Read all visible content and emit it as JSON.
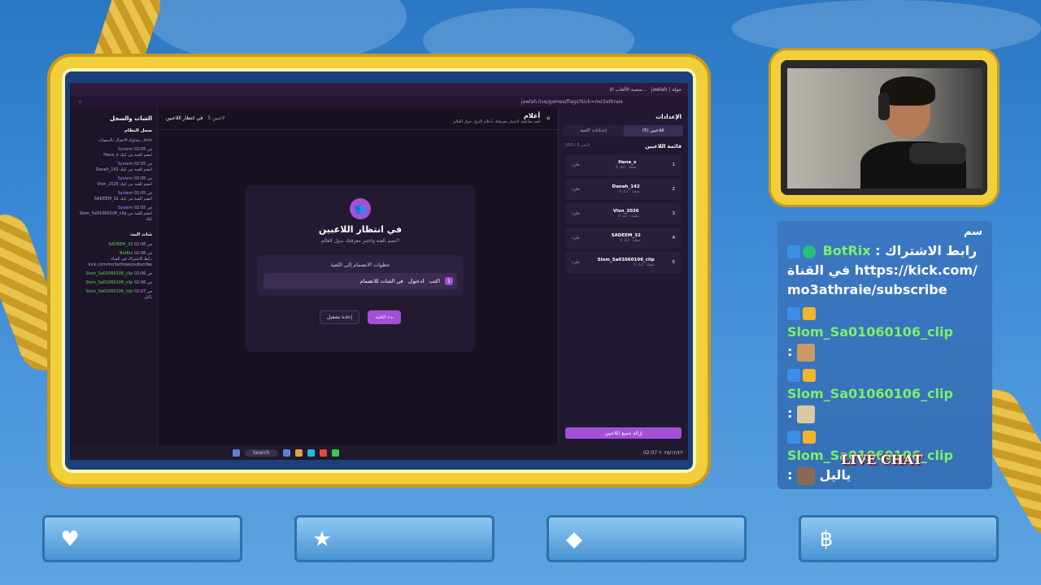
{
  "browser": {
    "tab_labels": [
      "منصة الألعاب الا...",
      "jawlah | جولة"
    ],
    "url": "jawlah.live/games/flags?kick=mo3athraie"
  },
  "left_panel": {
    "title": "الشات والسجل",
    "log_title": "سجل النظام",
    "log_items": [
      {
        "name": "",
        "text": "محاولة الاتصال بالمنصات...kick"
      },
      {
        "name": "System",
        "time": "02:05 ص",
        "text": "Hana_x انضم للعبة من كيك"
      },
      {
        "name": "System",
        "time": "02:05 ص",
        "text": "Danah_142 انضم للعبة من كيك"
      },
      {
        "name": "System",
        "time": "02:05 ص",
        "text": "Vlon_2026 انضم للعبة من كيك"
      },
      {
        "name": "System",
        "time": "02:05 ص",
        "text": "SADEEM_32 انضم للعبة من كيك"
      },
      {
        "name": "System",
        "time": "02:05 ص",
        "text": "Slom_Sa01060106_clip انضم للعبة من كيك"
      }
    ],
    "chat_title": "شات البث",
    "chat_items": [
      {
        "name": "SADEEM_32",
        "time": "02:06 ص",
        "text": ""
      },
      {
        "name": "BotRix",
        "time": "02:06 ص",
        "text": "رابط الاشتراك في القناة kick.com/mo3athraie/subscribe"
      },
      {
        "name": "Slom_Sa01060106_clip",
        "time": "02:06 ص",
        "text": ""
      },
      {
        "name": "Slom_Sa01060106_clip",
        "time": "02:06 ص",
        "text": ""
      },
      {
        "name": "Slom_Sa01060106_clip",
        "time": "02:07 ص",
        "text": "ياليل"
      }
    ]
  },
  "middle": {
    "status": "في انتظار اللاعبين",
    "count": "5 لاعبين",
    "title": "أعلام",
    "subtitle": "لعبة تفاعلية لاختبار معرفتك بأعلام الدول حول العالم",
    "panel_title": "في انتظار اللاعبين",
    "panel_sub": "انضم للعبة واختبر معرفتك بدول العالم!",
    "steps_title": "خطوات الانضمام إلى اللعبة",
    "step_num": "1",
    "step_pre": "اكتب",
    "step_kw": "ادخول",
    "step_post": "في الشات للانضمام",
    "btn_start": "بدء اللعبة",
    "btn_restart": "إعادة تشغيل"
  },
  "right_panel": {
    "settings_title": "الإعدادات",
    "tab_players": "اللاعبين (5)",
    "tab_game_settings": "إعدادات اللعبة",
    "players_title": "قائمة اللاعبين",
    "players_count": "100 / 5 لاعب",
    "players": [
      {
        "rank": "1",
        "name": "Hana_x",
        "sub": "0 نقطة · كيك",
        "action": "طرد"
      },
      {
        "rank": "2",
        "name": "Danah_142",
        "sub": "0 نقطة · كيك",
        "action": "طرد"
      },
      {
        "rank": "3",
        "name": "Vlon_2026",
        "sub": "0 نقطة · كيك",
        "action": "طرد"
      },
      {
        "rank": "4",
        "name": "SADEEM_32",
        "sub": "0 نقطة · كيك",
        "action": "طرد"
      },
      {
        "rank": "5",
        "name": "Slom_Sa01060106_clip",
        "sub": "0 نقطة · كيك",
        "action": "طرد"
      }
    ],
    "clear_btn": "إزالة جميع اللاعبين"
  },
  "taskbar": {
    "search": "Search",
    "time": "02:07",
    "date": "٢٠٢٥/١٢/٢٢"
  },
  "stream_chat": {
    "header": "سم",
    "messages": [
      {
        "user": "BotRix",
        "sep": " : ",
        "text": "رابط الاشتراك في القناة https://kick.com/mo3athraie/subscribe"
      },
      {
        "user": "Slom_Sa01060106_clip",
        "sep": " : ",
        "text": ""
      },
      {
        "user": "Slom_Sa01060106_clip",
        "sep": " : ",
        "text": ""
      },
      {
        "user": "Slom_Sa01060106_clip",
        "sep": " : ",
        "text": "ياليل"
      }
    ],
    "live_chat_label": "LIVE CHAT"
  },
  "icons": {
    "plaques": [
      "heart-icon",
      "star-icon",
      "diamond-icon",
      "coin-icon"
    ]
  },
  "colors": {
    "accent": "#a44fd6",
    "frame": "#f2cf3a",
    "chat_user": "#7cf06a"
  }
}
